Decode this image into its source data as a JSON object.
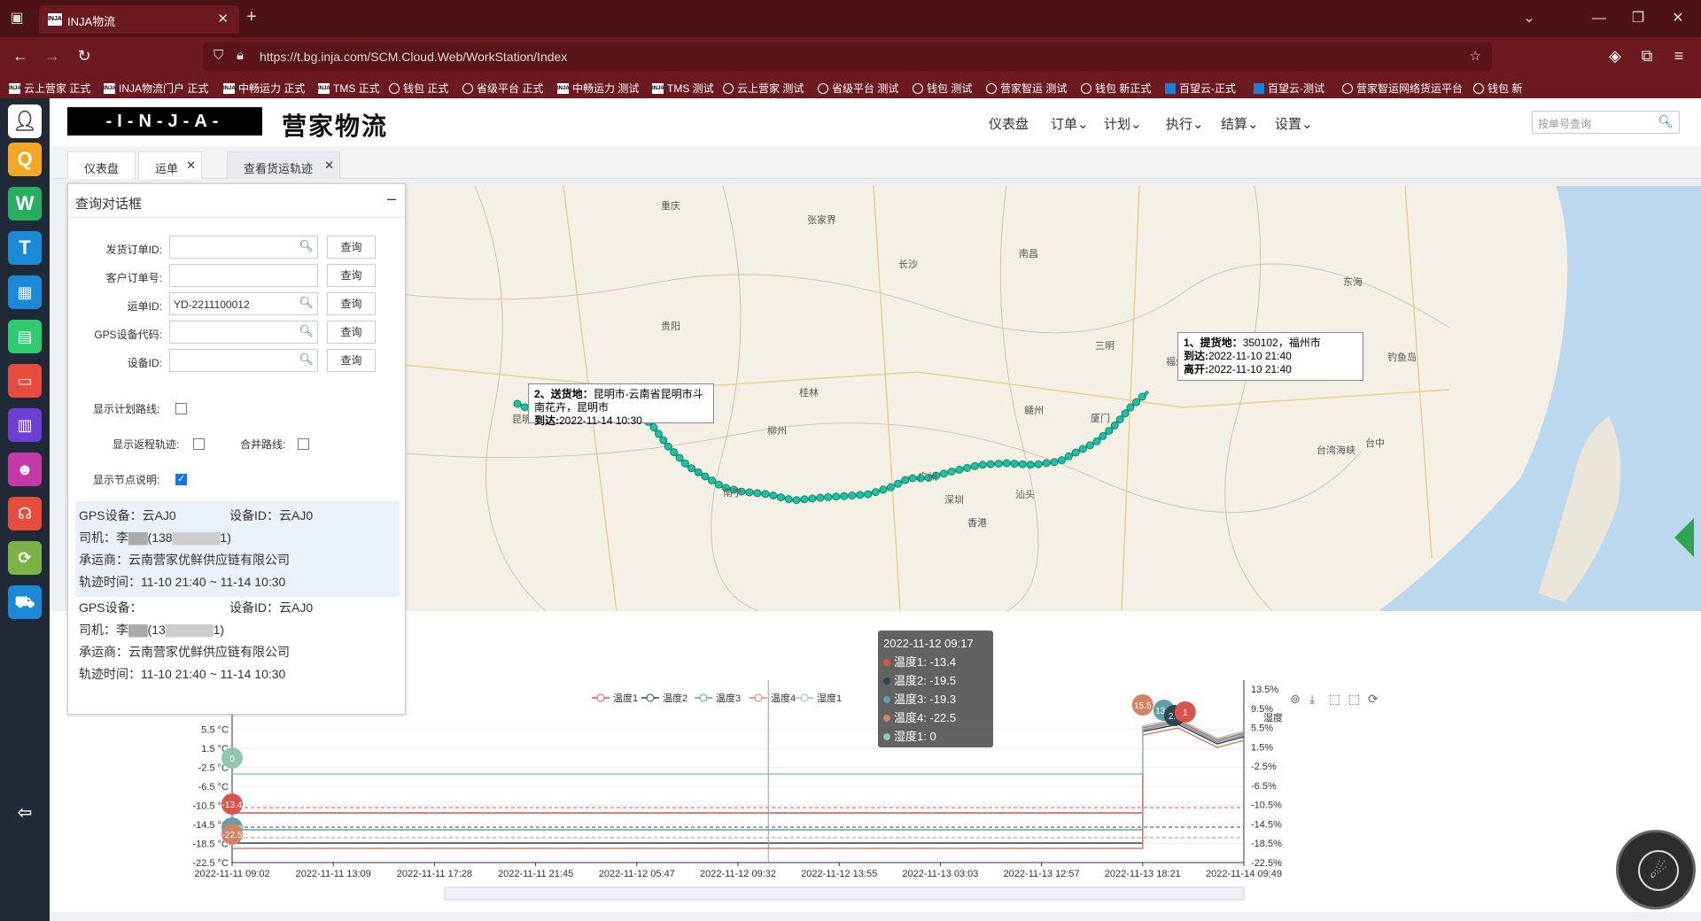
{
  "browser": {
    "tab_title": "INJA物流",
    "url": "https://t.bg.inja.com/SCM.Cloud.Web/WorkStation/Index",
    "bookmarks": [
      {
        "label": "云上营家 正式",
        "icon": "inja"
      },
      {
        "label": "INJA物流门户 正式",
        "icon": "inja"
      },
      {
        "label": "中畅运力 正式",
        "icon": "inja"
      },
      {
        "label": "TMS 正式",
        "icon": "inja"
      },
      {
        "label": "钱包 正式",
        "icon": "globe"
      },
      {
        "label": "省级平台 正式",
        "icon": "globe"
      },
      {
        "label": "中畅运力 测试",
        "icon": "inja"
      },
      {
        "label": "TMS 测试",
        "icon": "inja"
      },
      {
        "label": "云上营家 测试",
        "icon": "globe"
      },
      {
        "label": "省级平台 测试",
        "icon": "globe"
      },
      {
        "label": "钱包 测试",
        "icon": "globe"
      },
      {
        "label": "营家智运 测试",
        "icon": "globe"
      },
      {
        "label": "钱包 新正式",
        "icon": "globe"
      },
      {
        "label": "百望云-正式",
        "icon": "baiwang"
      },
      {
        "label": "百望云-测试",
        "icon": "baiwang"
      },
      {
        "label": "营家智运网络货运平台",
        "icon": "globe"
      },
      {
        "label": "钱包 新",
        "icon": "globe"
      }
    ]
  },
  "app": {
    "logo": "-I-N-J-A-",
    "logo_cn": "营家物流",
    "menus": [
      "仪表盘",
      "订单",
      "计划",
      "执行",
      "结算",
      "设置"
    ],
    "search_placeholder": "按单号查询",
    "page_tabs": [
      "仪表盘",
      "运单",
      "查看货运轨迹"
    ]
  },
  "panel": {
    "title": "查询对话框",
    "fields": [
      {
        "label": "发货订单ID:",
        "value": "",
        "button": "查询"
      },
      {
        "label": "客户订单号:",
        "value": "",
        "button": "查询"
      },
      {
        "label": "运单ID:",
        "value": "YD-2211100012",
        "button": "查询"
      },
      {
        "label": "GPS设备代码:",
        "value": "",
        "button": "查询"
      },
      {
        "label": "设备ID:",
        "value": "",
        "button": "查询"
      }
    ],
    "checks": {
      "plan_route": "显示计划路线:",
      "return_track": "显示返程轨迹:",
      "merge_route": "合并路线:",
      "node_desc": "显示节点说明:"
    },
    "gps": [
      {
        "device": "GPS设备：云AJ0",
        "device_id": "设备ID：云AJ0",
        "driver": "司机：李",
        "phone": "(138",
        "phone_end": "1)",
        "carrier": "承运商：云南营家优鲜供应链有限公司",
        "track": "轨迹时间：11-10 21:40 ~ 11-14 10:30"
      },
      {
        "device": "GPS设备：",
        "device_id": "设备ID：云AJ0",
        "driver": "司机：李",
        "phone": "(13",
        "phone_end": "1)",
        "carrier": "承运商：云南营家优鲜供应链有限公司",
        "track": "轨迹时间：11-10 21:40 ~ 11-14 10:30"
      }
    ]
  },
  "map": {
    "labels": [
      {
        "t": "重庆"
      },
      {
        "t": "长沙"
      },
      {
        "t": "南昌"
      },
      {
        "t": "贵阳"
      },
      {
        "t": "福州"
      },
      {
        "t": "昆明"
      },
      {
        "t": "南宁"
      },
      {
        "t": "广州"
      },
      {
        "t": "深圳"
      },
      {
        "t": "香港"
      },
      {
        "t": "东海"
      },
      {
        "t": "台湾海峡"
      },
      {
        "t": "台中"
      },
      {
        "t": "钓鱼岛"
      },
      {
        "t": "张家界"
      },
      {
        "t": "桂林"
      },
      {
        "t": "柳州"
      },
      {
        "t": "厦门"
      },
      {
        "t": "三明"
      },
      {
        "t": "汕头"
      },
      {
        "t": "赣州"
      }
    ],
    "popup_origin": {
      "title": "1、提货地：",
      "place": "350102，福州市",
      "arrive": "到达:",
      "arrive_time": "2022-11-10 21:40",
      "leave": "离开:",
      "leave_time": "2022-11-10 21:40"
    },
    "popup_dest": {
      "title": "2、送货地：",
      "place": "昆明市-云南省昆明市斗南花卉，昆明市",
      "arrive": "到达:",
      "arrive_time": "2022-11-14 10:30"
    }
  },
  "chart_data": {
    "type": "line",
    "legend": [
      "温度1",
      "温度2",
      "温度3",
      "温度4",
      "湿度1"
    ],
    "colors": [
      "#d9534f",
      "#2f4554",
      "#61a0a8",
      "#d48265",
      "#91c7ae"
    ],
    "x_ticks": [
      "2022-11-11 09:02",
      "2022-11-11 13:09",
      "2022-11-11 17:28",
      "2022-11-11 21:45",
      "2022-11-12 05:47",
      "2022-11-12 09:32",
      "2022-11-12 13:55",
      "2022-11-13 03:03",
      "2022-11-13 12:57",
      "2022-11-13 18:21",
      "2022-11-14 09:49"
    ],
    "y_left_ticks": [
      "5.5 °C",
      "1.5 °C",
      "-2.5 °C",
      "-6.5 °C",
      "-10.5 °C",
      "-14.5 °C",
      "-18.5 °C",
      "-22.5 °C"
    ],
    "y_right_ticks": [
      "13.5%",
      "9.5%",
      "5.5%",
      "1.5%",
      "-2.5%",
      "-6.5%",
      "-10.5%",
      "-14.5%",
      "-18.5%",
      "-22.5%"
    ],
    "y_right_label": "湿度",
    "tooltip": {
      "time": "2022-11-12 09:17",
      "rows": [
        "温度1: -13.4",
        "温度2: -19.5",
        "温度3: -19.3",
        "温度4: -22.5",
        "湿度1: 0"
      ]
    },
    "markers_start": [
      "0",
      "-13.4",
      "-19.3",
      "-22.5"
    ],
    "markers_peak": [
      "15.5",
      "13.8",
      "2.3",
      "1"
    ]
  }
}
